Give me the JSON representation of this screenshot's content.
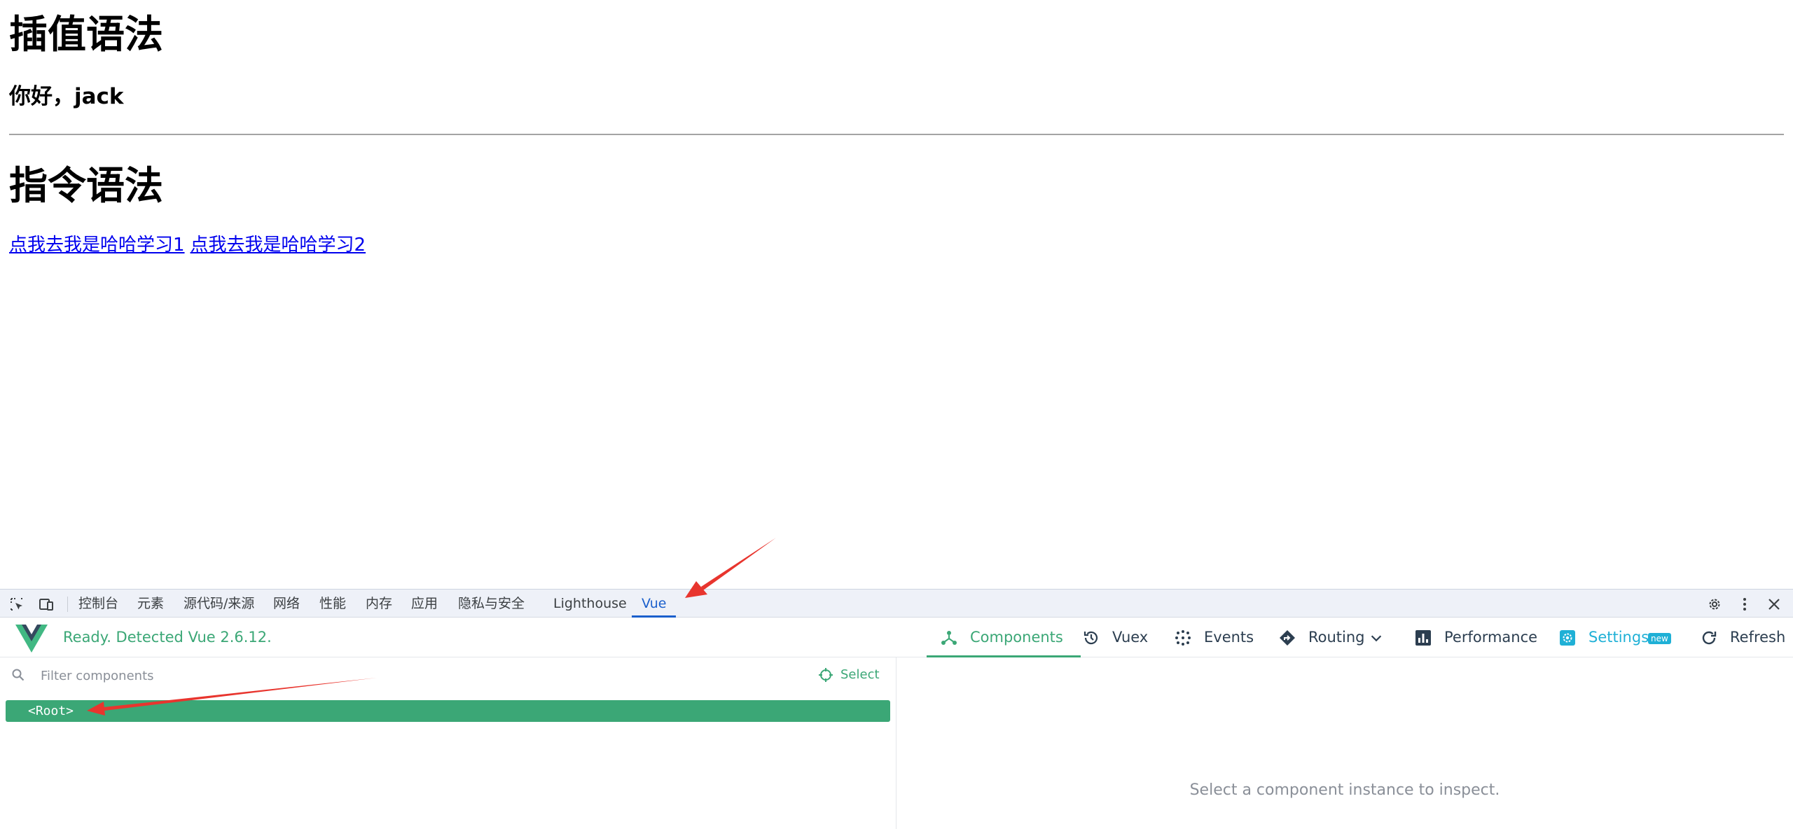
{
  "page": {
    "heading_interpolation": "插值语法",
    "greeting": "你好，jack",
    "heading_directive": "指令语法",
    "links": [
      "点我去我是哈哈学习1",
      "点我去我是哈哈学习2"
    ]
  },
  "devtools": {
    "tabs": [
      "控制台",
      "元素",
      "源代码/来源",
      "网络",
      "性能",
      "内存",
      "应用",
      "隐私与安全",
      "Lighthouse",
      "Vue"
    ],
    "active_tab": "Vue"
  },
  "vue_devtools": {
    "status": "Ready. Detected Vue 2.6.12.",
    "nav": {
      "components": "Components",
      "vuex": "Vuex",
      "events": "Events",
      "routing": "Routing",
      "performance": "Performance",
      "settings": "Settings",
      "settings_badge": "new",
      "refresh": "Refresh"
    },
    "filter_placeholder": "Filter components",
    "select_label": "Select",
    "root_component": "<Root>",
    "inspect_message": "Select a component instance to inspect."
  },
  "colors": {
    "vue_green": "#3ba776",
    "devtools_blue": "#1a5fcc",
    "link_blue": "#0000ee",
    "annotation_red": "#e8352e",
    "settings_cyan": "#1fb0d6"
  }
}
